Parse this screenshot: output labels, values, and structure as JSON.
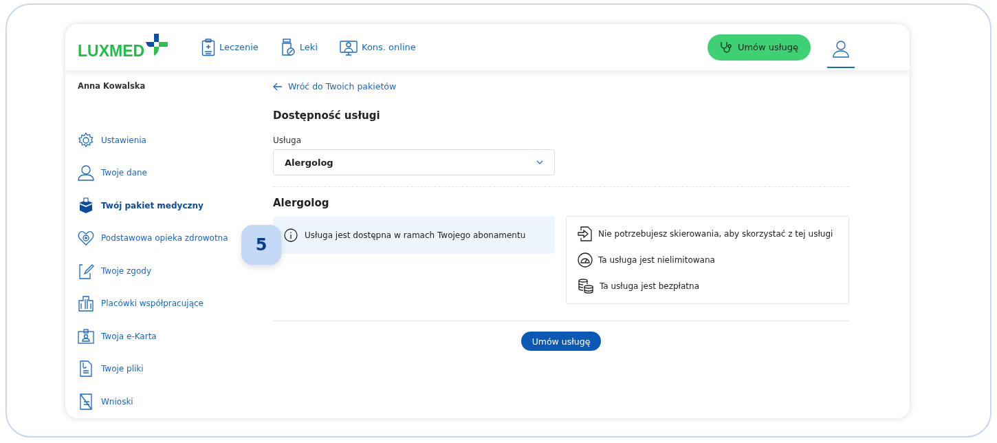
{
  "header": {
    "logo": "LUXMED",
    "nav": [
      {
        "label": "Leczenie"
      },
      {
        "label": "Leki"
      },
      {
        "label": "Kons. online"
      }
    ],
    "cta": "Umów usługę"
  },
  "sidebar": {
    "user": "Anna Kowalska",
    "items": [
      {
        "label": "Ustawienia",
        "selected": false
      },
      {
        "label": "Twoje dane",
        "selected": false
      },
      {
        "label": "Twój pakiet medyczny",
        "selected": true
      },
      {
        "label": "Podstawowa opieka zdrowotna",
        "selected": false
      },
      {
        "label": "Twoje zgody",
        "selected": false
      },
      {
        "label": "Placówki współpracujące",
        "selected": false
      },
      {
        "label": "Twoja e-Karta",
        "selected": false
      },
      {
        "label": "Twoje pliki",
        "selected": false
      },
      {
        "label": "Wnioski",
        "selected": false
      }
    ]
  },
  "main": {
    "back_link": "Wróć do Twoich pakietów",
    "title": "Dostępność usługi",
    "field_label": "Usługa",
    "field_value": "Alergolog",
    "section_title": "Alergolog",
    "info": "Usługa jest dostępna w ramach Twojego abonamentu",
    "features": [
      "Nie potrzebujesz skierowania, aby skorzystać z tej usługi",
      "Ta usługa jest nielimitowana",
      "Ta usługa jest bezpłatna"
    ],
    "button": "Umów usługę"
  },
  "step_badge": "5"
}
